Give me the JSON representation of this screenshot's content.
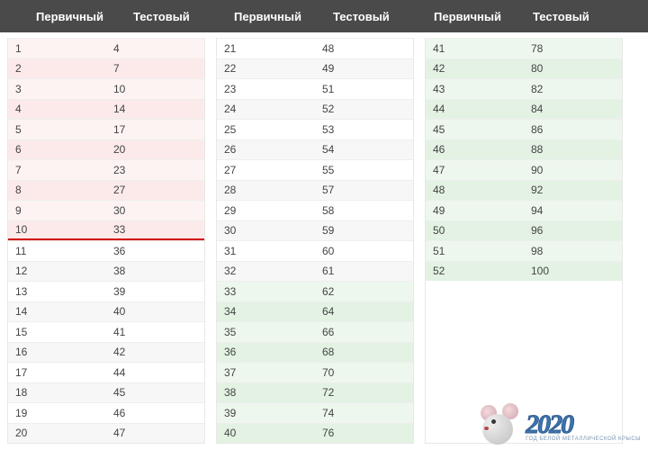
{
  "headers": {
    "primary": "Первичный",
    "test": "Тестовый"
  },
  "column1": {
    "red_rows": [
      {
        "p": "1",
        "t": "4"
      },
      {
        "p": "2",
        "t": "7"
      },
      {
        "p": "3",
        "t": "10"
      },
      {
        "p": "4",
        "t": "14"
      },
      {
        "p": "5",
        "t": "17"
      },
      {
        "p": "6",
        "t": "20"
      },
      {
        "p": "7",
        "t": "23"
      },
      {
        "p": "8",
        "t": "27"
      },
      {
        "p": "9",
        "t": "30"
      },
      {
        "p": "10",
        "t": "33"
      }
    ],
    "plain_rows": [
      {
        "p": "11",
        "t": "36"
      },
      {
        "p": "12",
        "t": "38"
      },
      {
        "p": "13",
        "t": "39"
      },
      {
        "p": "14",
        "t": "40"
      },
      {
        "p": "15",
        "t": "41"
      },
      {
        "p": "16",
        "t": "42"
      },
      {
        "p": "17",
        "t": "44"
      },
      {
        "p": "18",
        "t": "45"
      },
      {
        "p": "19",
        "t": "46"
      },
      {
        "p": "20",
        "t": "47"
      }
    ]
  },
  "column2": {
    "plain_rows": [
      {
        "p": "21",
        "t": "48"
      },
      {
        "p": "22",
        "t": "49"
      },
      {
        "p": "23",
        "t": "51"
      },
      {
        "p": "24",
        "t": "52"
      },
      {
        "p": "25",
        "t": "53"
      },
      {
        "p": "26",
        "t": "54"
      },
      {
        "p": "27",
        "t": "55"
      },
      {
        "p": "28",
        "t": "57"
      },
      {
        "p": "29",
        "t": "58"
      },
      {
        "p": "30",
        "t": "59"
      },
      {
        "p": "31",
        "t": "60"
      },
      {
        "p": "32",
        "t": "61"
      }
    ],
    "green_rows": [
      {
        "p": "33",
        "t": "62"
      },
      {
        "p": "34",
        "t": "64"
      },
      {
        "p": "35",
        "t": "66"
      },
      {
        "p": "36",
        "t": "68"
      },
      {
        "p": "37",
        "t": "70"
      },
      {
        "p": "38",
        "t": "72"
      },
      {
        "p": "39",
        "t": "74"
      },
      {
        "p": "40",
        "t": "76"
      }
    ]
  },
  "column3": {
    "green_rows": [
      {
        "p": "41",
        "t": "78"
      },
      {
        "p": "42",
        "t": "80"
      },
      {
        "p": "43",
        "t": "82"
      },
      {
        "p": "44",
        "t": "84"
      },
      {
        "p": "45",
        "t": "86"
      },
      {
        "p": "46",
        "t": "88"
      },
      {
        "p": "47",
        "t": "90"
      },
      {
        "p": "48",
        "t": "92"
      },
      {
        "p": "49",
        "t": "94"
      },
      {
        "p": "50",
        "t": "96"
      },
      {
        "p": "51",
        "t": "98"
      },
      {
        "p": "52",
        "t": "100"
      }
    ]
  },
  "watermark": {
    "year": "2020",
    "subtitle": "ГОД БЕЛОЙ МЕТАЛЛИЧЕСКОЙ КРЫСЫ"
  }
}
